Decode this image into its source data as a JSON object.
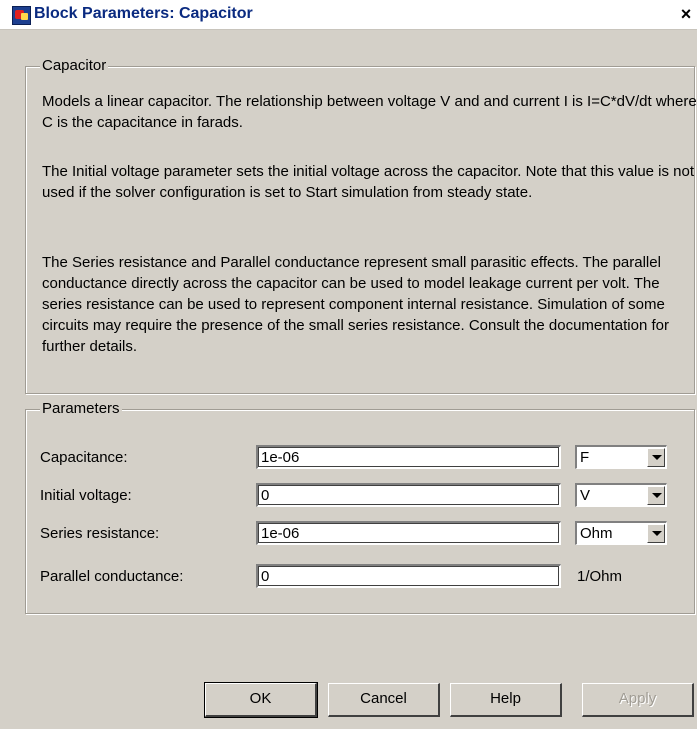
{
  "window": {
    "title": "Block Parameters: Capacitor",
    "close_glyph": "×"
  },
  "description_group": {
    "legend": "Capacitor",
    "paragraphs": [
      "Models a linear capacitor. The relationship between voltage V and and current I is I=C*dV/dt where C is the capacitance in farads.",
      "The Initial voltage parameter sets the initial voltage across the capacitor. Note that this value is not used if the solver configuration is set to Start simulation from steady state.",
      "The Series resistance and Parallel conductance represent small parasitic effects. The parallel conductance directly across the capacitor can be used to model leakage current per volt. The series resistance can be used to represent component internal resistance. Simulation of some circuits may require the presence of the small series resistance. Consult the documentation for further details."
    ]
  },
  "parameters_group": {
    "legend": "Parameters",
    "rows": [
      {
        "label": "Capacitance:",
        "value": "1e-06",
        "unit": "F"
      },
      {
        "label": "Initial voltage:",
        "value": "0",
        "unit": "V"
      },
      {
        "label": "Series resistance:",
        "value": "1e-06",
        "unit": "Ohm"
      },
      {
        "label": "Parallel conductance:",
        "value": "0",
        "unit": "1/Ohm"
      }
    ]
  },
  "buttons": {
    "ok": "OK",
    "cancel": "Cancel",
    "help": "Help",
    "apply": "Apply"
  },
  "icons": {
    "app": "simulink-block-icon",
    "close": "close-icon",
    "dropdown": "chevron-down-icon"
  },
  "colors": {
    "dialog_bg": "#d4d0c8",
    "title_text": "#0a2a80"
  }
}
